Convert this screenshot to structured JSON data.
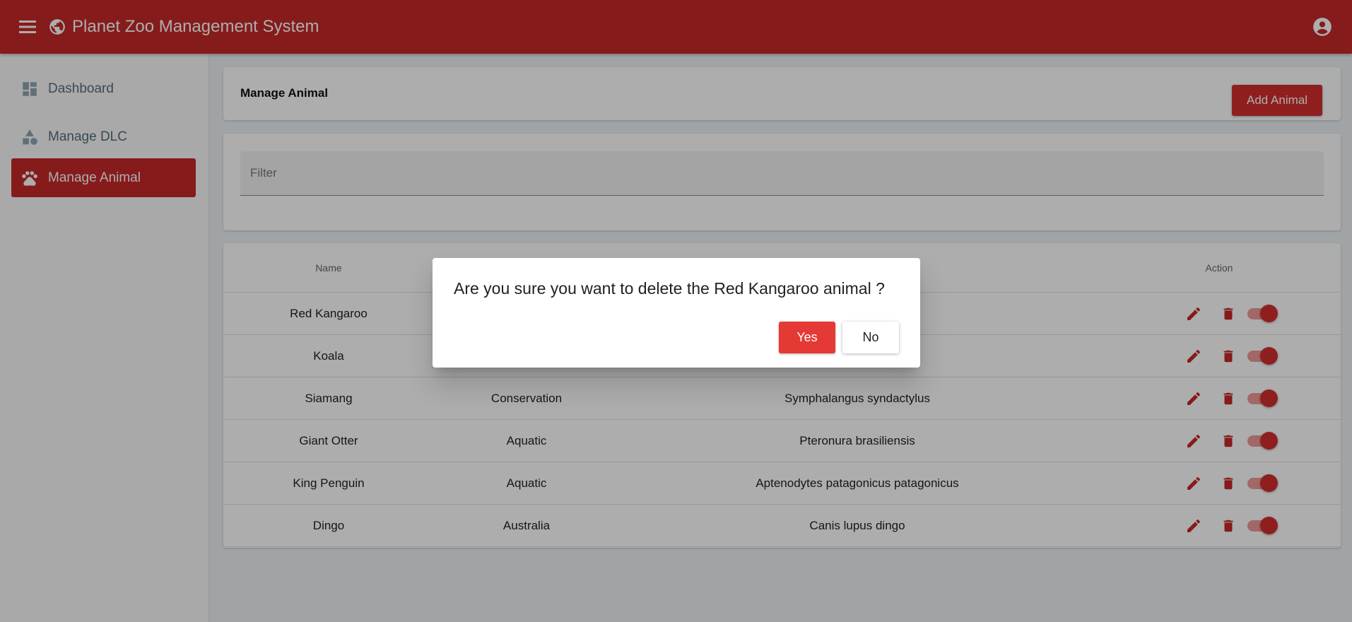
{
  "toolbar": {
    "title": "Planet Zoo Management System",
    "menu_icon": "menu-icon",
    "logo_icon": "globe-icon",
    "account_icon": "account-circle-icon",
    "color": "#c62828"
  },
  "sidebar": {
    "items": [
      {
        "label": "Dashboard",
        "icon": "dashboard-icon",
        "active": false
      },
      {
        "label": "Manage DLC",
        "icon": "category-icon",
        "active": false
      },
      {
        "label": "Manage Animal",
        "icon": "paw-icon",
        "active": true
      }
    ]
  },
  "header": {
    "title": "Manage Animal",
    "add_button": "Add Animal"
  },
  "filter": {
    "placeholder": "Filter",
    "value": ""
  },
  "table": {
    "columns": [
      "Name",
      "",
      "",
      "Action"
    ],
    "rows": [
      {
        "name": "Red Kangaroo",
        "dlc": "",
        "scientific": ""
      },
      {
        "name": "Koala",
        "dlc": "",
        "scientific": ""
      },
      {
        "name": "Siamang",
        "dlc": "Conservation",
        "scientific": "Symphalangus syndactylus"
      },
      {
        "name": "Giant Otter",
        "dlc": "Aquatic",
        "scientific": "Pteronura brasiliensis"
      },
      {
        "name": "King Penguin",
        "dlc": "Aquatic",
        "scientific": "Aptenodytes patagonicus patagonicus"
      },
      {
        "name": "Dingo",
        "dlc": "Australia",
        "scientific": "Canis lupus dingo"
      }
    ],
    "action_icons": [
      "edit-icon",
      "delete-icon",
      "toggle"
    ]
  },
  "dialog": {
    "message": "Are you sure you want to delete the Red Kangaroo animal ?",
    "yes": "Yes",
    "no": "No"
  },
  "colors": {
    "primary": "#c62828",
    "danger": "#e53935",
    "toggle_track": "#ef9a9a"
  }
}
